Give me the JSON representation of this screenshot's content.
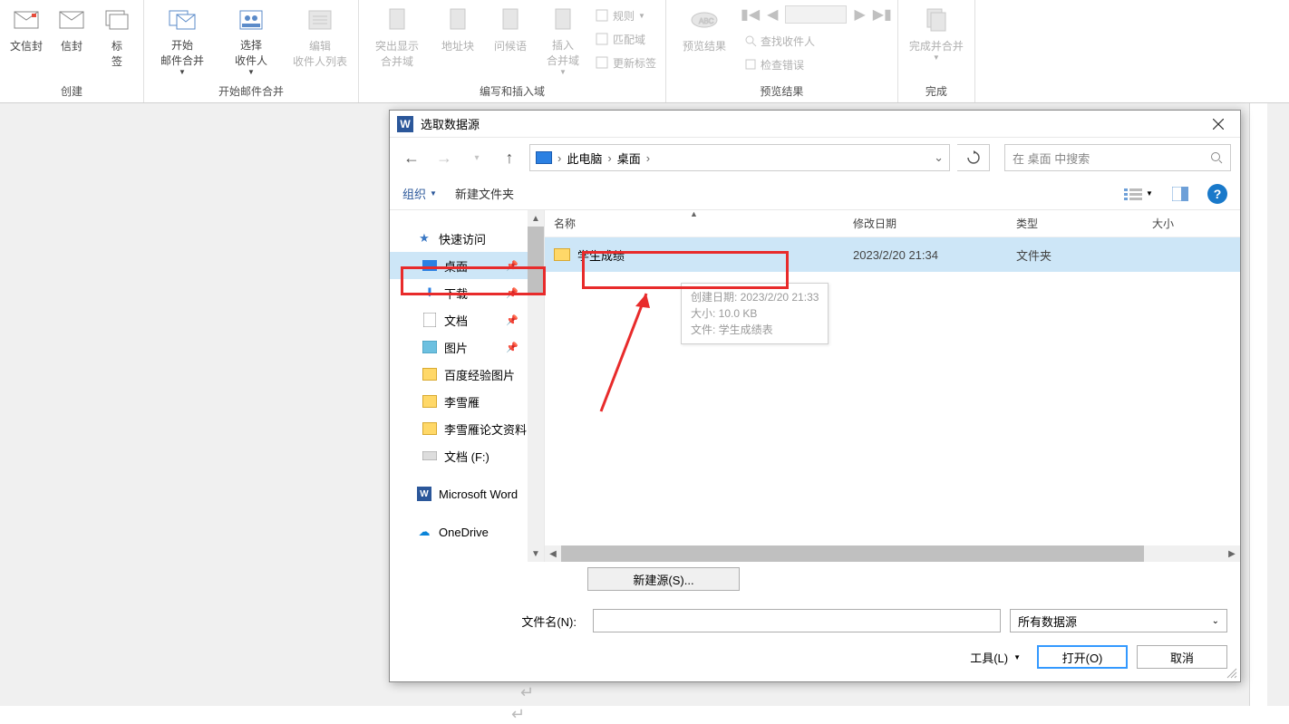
{
  "ribbon": {
    "groups": {
      "create": {
        "label": "创建",
        "buttons": {
          "chinese_envelope": "文信封",
          "envelope": "信封",
          "labels": "标\n签"
        }
      },
      "start": {
        "label": "开始邮件合并",
        "buttons": {
          "start_merge": "开始\n邮件合并",
          "select_recipients": "选择\n收件人",
          "edit_list": "编辑\n收件人列表"
        }
      },
      "write": {
        "label": "编写和插入域",
        "buttons": {
          "highlight": "突出显示\n合并域",
          "address_block": "地址块",
          "greeting": "问候语",
          "insert_field": "插入\n合并域"
        },
        "side": {
          "rules": "规则",
          "match": "匹配域",
          "update_labels": "更新标签"
        }
      },
      "preview": {
        "label": "预览结果",
        "buttons": {
          "preview": "预览结果"
        },
        "side": {
          "find": "查找收件人",
          "check": "检查错误"
        }
      },
      "finish": {
        "label": "完成",
        "buttons": {
          "finish": "完成并合并"
        }
      }
    }
  },
  "dialog": {
    "title": "选取数据源",
    "breadcrumb": {
      "pc": "此电脑",
      "desktop": "桌面"
    },
    "search_placeholder": "在 桌面 中搜索",
    "toolbar": {
      "organize": "组织",
      "new_folder": "新建文件夹"
    },
    "sidebar": {
      "quick_access": "快速访问",
      "desktop": "桌面",
      "downloads": "下载",
      "documents": "文档",
      "pictures": "图片",
      "baidu": "百度经验图片",
      "lixueyan": "李雪雁",
      "lixueyan_thesis": "李雪雁论文资料",
      "docs_f": "文档 (F:)",
      "msword": "Microsoft Word",
      "onedrive": "OneDrive"
    },
    "columns": {
      "name": "名称",
      "date": "修改日期",
      "type": "类型",
      "size": "大小"
    },
    "rows": [
      {
        "name": "学生成绩",
        "date": "2023/2/20 21:34",
        "type": "文件夹"
      }
    ],
    "tooltip": {
      "l1": "创建日期: 2023/2/20 21:33",
      "l2": "大小: 10.0 KB",
      "l3": "文件: 学生成绩表"
    },
    "new_source": "新建源(S)...",
    "file_label": "文件名(N):",
    "filter": "所有数据源",
    "tools": "工具(L)",
    "open": "打开(O)",
    "cancel": "取消"
  }
}
